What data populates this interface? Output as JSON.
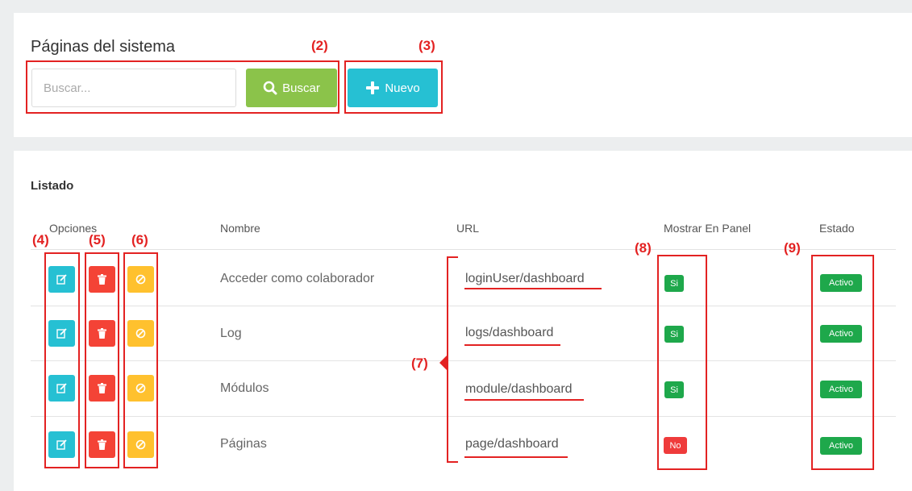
{
  "header": {
    "title": "Páginas del sistema",
    "search_placeholder": "Buscar...",
    "search_value": "",
    "search_button": "Buscar",
    "new_button": "Nuevo"
  },
  "list": {
    "title": "Listado",
    "columns": [
      "Opciones",
      "Nombre",
      "URL",
      "Mostrar En Panel",
      "Estado"
    ],
    "rows": [
      {
        "name": "Acceder como colaborador",
        "url": "loginUser/dashboard",
        "show_in_panel": "Si",
        "status": "Activo"
      },
      {
        "name": "Log",
        "url": "logs/dashboard",
        "show_in_panel": "Si",
        "status": "Activo"
      },
      {
        "name": "Módulos",
        "url": "module/dashboard",
        "show_in_panel": "Si",
        "status": "Activo"
      },
      {
        "name": "Páginas",
        "url": "page/dashboard",
        "show_in_panel": "No",
        "status": "Activo"
      }
    ]
  },
  "annotations": {
    "label_2": "(2)",
    "label_3": "(3)",
    "label_4": "(4)",
    "label_5": "(5)",
    "label_6": "(6)",
    "label_7": "(7)",
    "label_8": "(8)",
    "label_9": "(9)"
  },
  "colors": {
    "search_button": "#8bc34a",
    "new_button": "#26c0d3",
    "edit": "#26c0d3",
    "delete": "#f44336",
    "disable": "#ffc12e",
    "badge_yes": "#1ea84b",
    "badge_no": "#ef3b3b",
    "annotation": "#e32222"
  },
  "icons": {
    "search": "magnifier-icon",
    "new": "plus-icon",
    "edit": "edit-icon",
    "delete": "trash-icon",
    "disable": "ban-icon"
  }
}
